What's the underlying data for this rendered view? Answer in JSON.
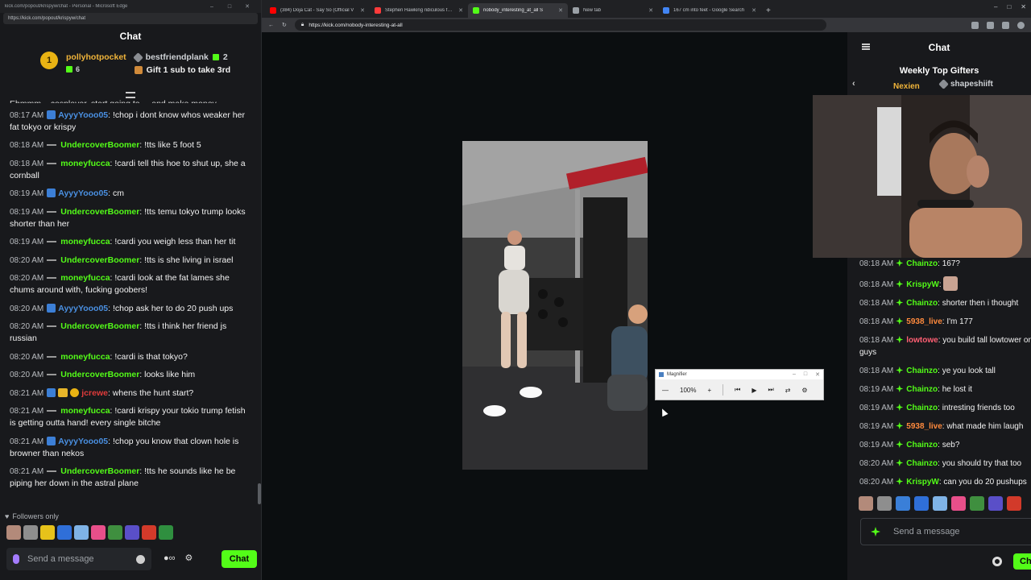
{
  "popout": {
    "title": "kick.com/popout/krispyw/chat - Personal - Microsoft Edge",
    "url": "https://kick.com/popout/krispyw/chat",
    "chat_title": "Chat",
    "gifter1": {
      "rank": "1",
      "name": "pollyhotpocket",
      "count": "6"
    },
    "gifter2": {
      "name": "bestfriendplank",
      "count": "2",
      "cta": "Gift 1 sub to take 3rd"
    },
    "partial_line": "Ehmmm... cosplayer, start going to ... and make money",
    "messages": [
      {
        "time": "08:17 AM",
        "user": "AyyyYooo05",
        "text": ": !chop i dont know whos weaker her fat tokyo or krispy"
      },
      {
        "time": "08:18 AM",
        "user": "UndercoverBoomer",
        "text": ": !tts like 5 foot 5"
      },
      {
        "time": "08:18 AM",
        "user": "moneyfucca",
        "text": ": !cardi tell this hoe to shut up, she a cornball"
      },
      {
        "time": "08:19 AM",
        "user": "AyyyYooo05",
        "text": ": cm"
      },
      {
        "time": "08:19 AM",
        "user": "UndercoverBoomer",
        "text": ": !tts temu tokyo trump looks shorter than her"
      },
      {
        "time": "08:19 AM",
        "user": "moneyfucca",
        "text": ": !cardi you weigh less than her tit"
      },
      {
        "time": "08:20 AM",
        "user": "UndercoverBoomer",
        "text": ": !tts is she living in israel"
      },
      {
        "time": "08:20 AM",
        "user": "moneyfucca",
        "text": ": !cardi look at the fat lames she chums around with, fucking goobers!"
      },
      {
        "time": "08:20 AM",
        "user": "AyyyYooo05",
        "text": ": !chop ask her to do 20 push ups"
      },
      {
        "time": "08:20 AM",
        "user": "UndercoverBoomer",
        "text": ": !tts i think her friend js russian"
      },
      {
        "time": "08:20 AM",
        "user": "moneyfucca",
        "text": ": !cardi is that tokyo?"
      },
      {
        "time": "08:20 AM",
        "user": "UndercoverBoomer",
        "text": ": looks like him"
      },
      {
        "time": "08:21 AM",
        "user": "jcrewe",
        "text": ": whens the hunt start?"
      },
      {
        "time": "08:21 AM",
        "user": "moneyfucca",
        "text": ": !cardi krispy your tokio trump fetish is getting outta hand! every single bitche"
      },
      {
        "time": "08:21 AM",
        "user": "AyyyYooo05",
        "text": ": !chop you know that clown hole is browner than nekos"
      },
      {
        "time": "08:21 AM",
        "user": "UndercoverBoomer",
        "text": ": !tts he sounds like he be piping her down in the astral plane"
      }
    ],
    "followers_only": "Followers only",
    "input_placeholder": "Send a message",
    "chat_button": "Chat"
  },
  "browser": {
    "tabs": [
      {
        "label": "(384) Doja Cat - Say So (Official V",
        "color": "#ff0000"
      },
      {
        "label": "Stephen Hawking ridiculous fake",
        "color": "#ff3b3b"
      },
      {
        "label": "nobody_interesting_at_all S",
        "color": "#53fc18"
      },
      {
        "label": "New tab",
        "color": "#9aa0a6"
      },
      {
        "label": "167 cm into feet - Google Search",
        "color": "#4285f4"
      }
    ],
    "url": "https://kick.com/nobody-interesting-at-all"
  },
  "magnifier": {
    "title": "Magnifier",
    "zoom": "100%"
  },
  "right_chat": {
    "title": "Chat",
    "gifters_title": "Weekly Top Gifters",
    "gifter1": "Nexien",
    "gifter2": "shapeshiift",
    "messages": [
      {
        "time": "08:18 AM",
        "user": "Chainzo",
        "text": ": 167?",
        "color": "lgreen"
      },
      {
        "time": "08:18 AM",
        "user": "KrispyW",
        "text": ":",
        "color": "lgreen",
        "emote": true
      },
      {
        "time": "08:18 AM",
        "user": "Chainzo",
        "text": ": shorter then i thought",
        "color": "lgreen"
      },
      {
        "time": "08:18 AM",
        "user": "5938_live",
        "text": ": I'm 177",
        "color": "orange"
      },
      {
        "time": "08:18 AM",
        "user": "lowtowe",
        "text": ": you build tall lowtower on guys",
        "color": "pink",
        "wrap": true
      },
      {
        "time": "08:18 AM",
        "user": "Chainzo",
        "text": ": ye you look tall",
        "color": "lgreen"
      },
      {
        "time": "08:19 AM",
        "user": "Chainzo",
        "text": ": he lost it",
        "color": "lgreen"
      },
      {
        "time": "08:19 AM",
        "user": "Chainzo",
        "text": ": intresting friends too",
        "color": "lgreen"
      },
      {
        "time": "08:19 AM",
        "user": "5938_live",
        "text": ": what made him laugh",
        "color": "orange"
      },
      {
        "time": "08:19 AM",
        "user": "Chainzo",
        "text": ": seb?",
        "color": "lgreen"
      },
      {
        "time": "08:20 AM",
        "user": "Chainzo",
        "text": ": you should try that too",
        "color": "lgreen"
      },
      {
        "time": "08:20 AM",
        "user": "KrispyW",
        "text": ": can you do 20 pushups",
        "color": "lgreen"
      }
    ],
    "input_placeholder": "Send a message",
    "chat_button": "Ch"
  },
  "colors": {
    "kick_green": "#53fc18",
    "gold": "#e9b313",
    "bg_panel": "#18191c"
  }
}
